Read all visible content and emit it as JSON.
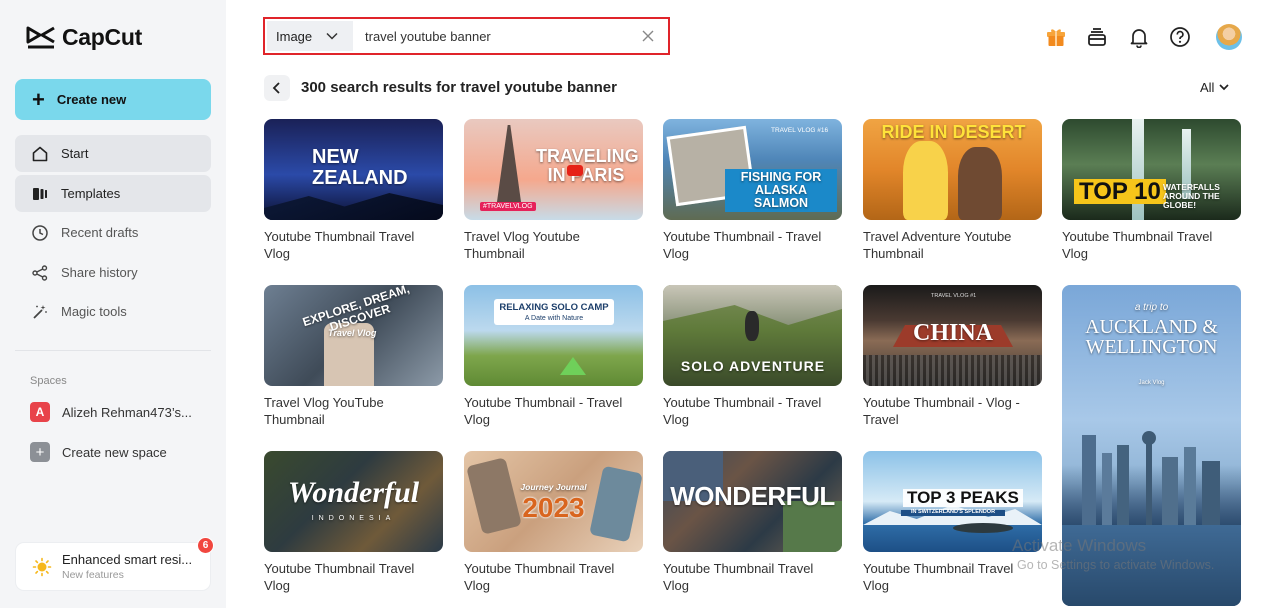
{
  "app": {
    "name": "CapCut"
  },
  "sidebar": {
    "create_label": "Create new",
    "items": [
      {
        "label": "Start",
        "icon": "home-icon"
      },
      {
        "label": "Templates",
        "icon": "templates-icon"
      },
      {
        "label": "Recent drafts",
        "icon": "clock-icon"
      },
      {
        "label": "Share history",
        "icon": "share-icon"
      },
      {
        "label": "Magic tools",
        "icon": "magic-wand-icon"
      }
    ],
    "spaces_label": "Spaces",
    "spaces": [
      {
        "avatar": "A",
        "label": "Alizeh Rehman473’s..."
      },
      {
        "avatar": "+",
        "label": "Create new space"
      }
    ],
    "notice": {
      "title": "Enhanced smart resi...",
      "subtitle": "New features",
      "badge": "6"
    }
  },
  "search": {
    "type": "Image",
    "value": "travel youtube banner"
  },
  "results": {
    "title": "300 search results for travel youtube banner",
    "filter": "All"
  },
  "colors": {
    "accent": "#7ad8ec",
    "search_border": "#e0242a",
    "badge": "#f1473f"
  },
  "cards": [
    {
      "caption": "Youtube Thumbnail Travel Vlog",
      "thumb_text": "NEW ZEALAND",
      "bg": "#1b2a6b"
    },
    {
      "caption": "Travel Vlog Youtube Thumbnail",
      "thumb_text": "TRAVELING IN PARIS",
      "bg": "#f2b49c",
      "thumb_tag": "#TRAVELVLOG"
    },
    {
      "caption": "Youtube Thumbnail - Travel Vlog",
      "thumb_text": "FISHING FOR ALASKA SALMON",
      "bg": "#3c7fb4",
      "thumb_tag": "TRAVEL VLOG #16"
    },
    {
      "caption": "Travel Adventure Youtube Thumbnail",
      "thumb_text": "RIDE IN DESERT",
      "bg": "#e3902c"
    },
    {
      "caption": "Youtube Thumbnail Travel Vlog",
      "thumb_text": "TOP 10",
      "thumb_tag": "WATERFALLS AROUND THE GLOBE!",
      "bg": "#203a28"
    },
    {
      "caption": "Travel Vlog YouTube Thumbnail",
      "thumb_text": "EXPLORE, DREAM, DISCOVER",
      "thumb_tag": "Travel Vlog",
      "bg": "#4c5b6e"
    },
    {
      "caption": "Youtube Thumbnail - Travel Vlog",
      "thumb_text": "RELAXING SOLO CAMP",
      "thumb_tag": "A Date with Nature",
      "bg": "#7fb6e0"
    },
    {
      "caption": "Youtube Thumbnail - Travel Vlog",
      "thumb_text": "SOLO ADVENTURE",
      "bg": "#6c7a3c"
    },
    {
      "caption": "Youtube Thumbnail - Vlog - Travel",
      "thumb_text": "CHINA",
      "thumb_tag": "TRAVEL VLOG #1",
      "bg": "#3a2f2c"
    },
    {
      "caption": "",
      "thumb_text": "AUCKLAND & WELLINGTON",
      "thumb_tag": "a trip to",
      "thumb_sub": "Jack Vlog",
      "bg": "#7aa7d8"
    },
    {
      "caption": "Youtube Thumbnail Travel Vlog",
      "thumb_text": "Wonderful",
      "thumb_tag": "INDONESIA",
      "bg": "#2f3b3e"
    },
    {
      "caption": "Youtube Thumbnail Travel Vlog",
      "thumb_text": "2023",
      "thumb_tag": "Journey Journal",
      "bg": "#d9b08c"
    },
    {
      "caption": "Youtube Thumbnail Travel Vlog",
      "thumb_text": "WONDERFUL",
      "bg": "#5a4a3c"
    },
    {
      "caption": "Youtube Thumbnail Travel Vlog",
      "thumb_text": "TOP 3 PEAKS",
      "thumb_tag": "IN SWITZERLAND'S SPLENDOR",
      "bg": "#8cc2e8"
    }
  ],
  "watermark": {
    "line1": "Activate Windows",
    "line2": "Go to Settings to activate Windows."
  }
}
